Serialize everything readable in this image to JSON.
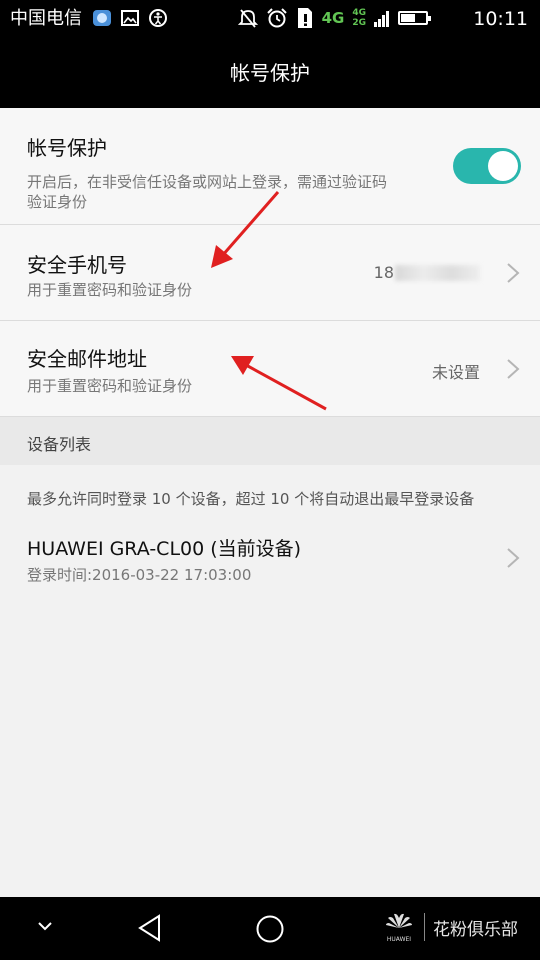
{
  "status_bar": {
    "carrier": "中国电信",
    "time": "10:11",
    "network_primary": "4G",
    "network_top": "4G",
    "network_bottom": "2G",
    "battery_level": 0.6,
    "icons_left": [
      "app-notification-icon",
      "image-icon",
      "accessibility-icon"
    ],
    "icons_right": [
      "mute-icon",
      "alarm-icon",
      "sim-icon"
    ]
  },
  "header": {
    "title": "帐号保护"
  },
  "account_protection": {
    "title": "帐号保护",
    "description_line1": "开启后，在非受信任设备或网站上登录，需通过验证码",
    "description_line2": "验证身份",
    "toggle_on": true,
    "toggle_color": "#29b6ad"
  },
  "security_phone": {
    "title": "安全手机号",
    "description": "用于重置密码和验证身份",
    "value_prefix": "18"
  },
  "security_email": {
    "title": "安全邮件地址",
    "description": "用于重置密码和验证身份",
    "value": "未设置"
  },
  "device_list": {
    "header": "设备列表",
    "notice": "最多允许同时登录 10 个设备，超过 10 个将自动退出最早登录设备",
    "devices": [
      {
        "name": "HUAWEI GRA-CL00 (当前设备)",
        "login_time": "登录时间:2016-03-22 17:03:00"
      }
    ]
  },
  "nav_bar": {
    "icons": [
      "chevron-down-icon",
      "back-icon",
      "home-icon"
    ]
  },
  "watermark": {
    "logo_text": "HUAWEI",
    "brand_text": "花粉俱乐部"
  },
  "colors": {
    "accent": "#29b6ad",
    "annotation_arrow": "#e02020"
  }
}
